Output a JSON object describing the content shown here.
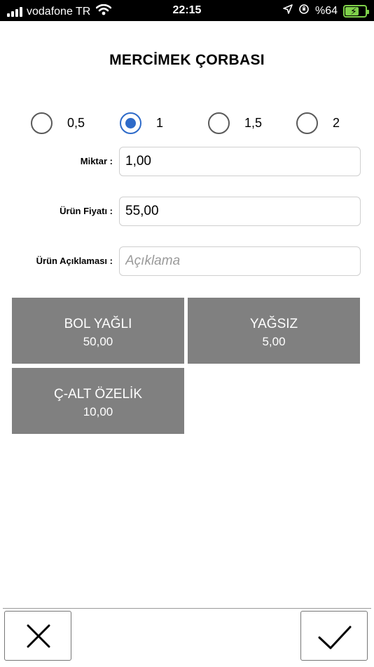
{
  "status_bar": {
    "carrier": "vodafone TR",
    "time": "22:15",
    "battery": "%64",
    "battery_level": 0.64,
    "battery_color": "#7fd14a"
  },
  "title": "MERCİMEK ÇORBASI",
  "portion": {
    "options": [
      "0,5",
      "1",
      "1,5",
      "2"
    ],
    "selected": "1",
    "accent_color": "#2e6bc9"
  },
  "fields": {
    "quantity": {
      "label": "Miktar :",
      "value": "1,00"
    },
    "price": {
      "label": "Ürün Fiyatı :",
      "value": "55,00"
    },
    "description": {
      "label": "Ürün Açıklaması :",
      "value": "",
      "placeholder": "Açıklama"
    }
  },
  "extras": [
    {
      "name": "BOL YAĞLI",
      "price": "50,00"
    },
    {
      "name": "YAĞSIZ",
      "price": "5,00"
    },
    {
      "name": "Ç-ALT ÖZELİK",
      "price": "10,00"
    }
  ],
  "tile_color": "#808080",
  "actions": {
    "cancel_icon": "close-icon",
    "confirm_icon": "check-icon"
  }
}
